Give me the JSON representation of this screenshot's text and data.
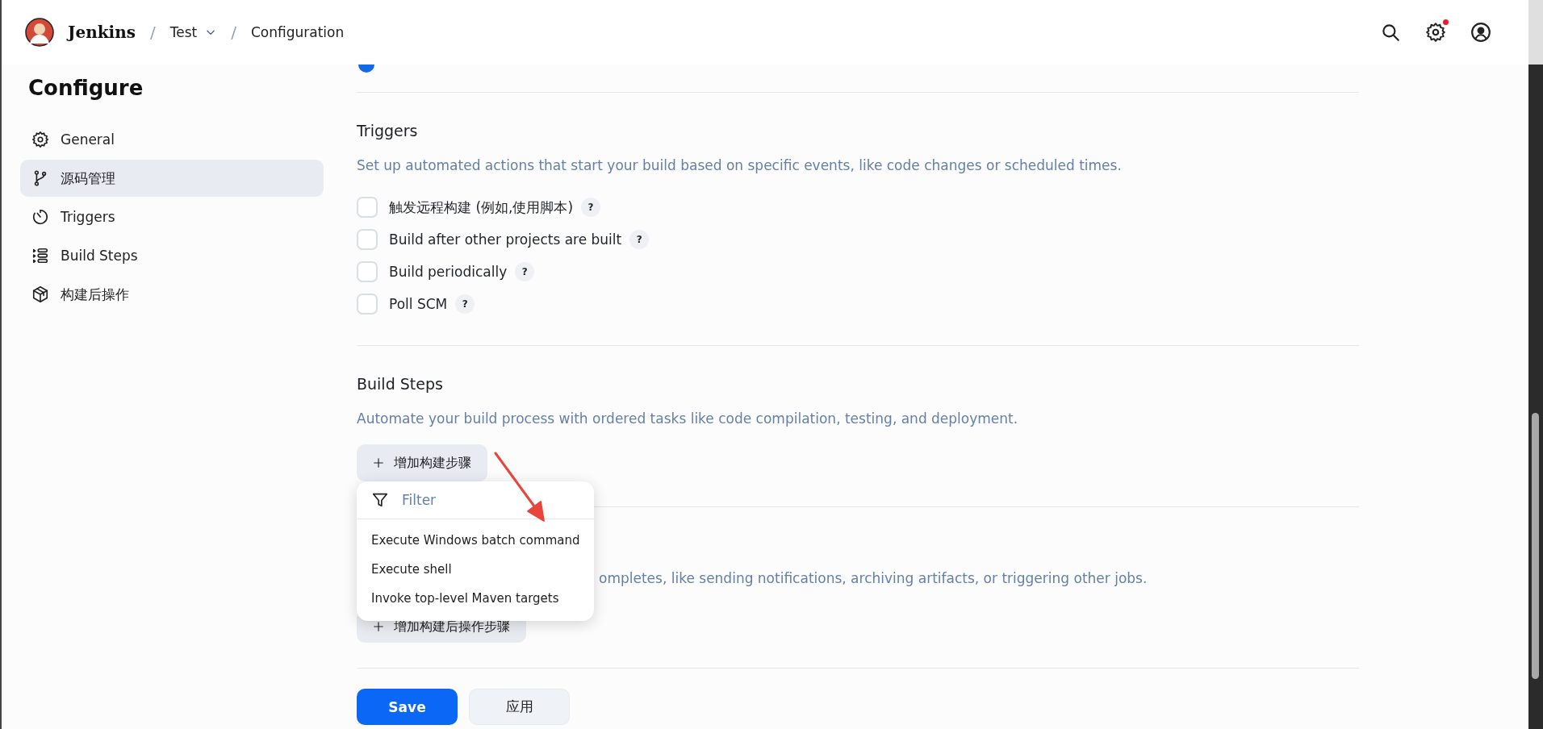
{
  "header": {
    "app_name": "Jenkins",
    "breadcrumbs": [
      {
        "separator": "/",
        "label": "Test",
        "dropdown": true
      },
      {
        "separator": "/",
        "label": "Configuration",
        "dropdown": false
      }
    ],
    "settings_alert": true
  },
  "sidebar": {
    "title": "Configure",
    "items": [
      {
        "label": "General",
        "selected": false
      },
      {
        "label": "源码管理",
        "selected": true
      },
      {
        "label": "Triggers",
        "selected": false
      },
      {
        "label": "Build Steps",
        "selected": false
      },
      {
        "label": "构建后操作",
        "selected": false
      }
    ]
  },
  "previous_section": {
    "radio_selected": true
  },
  "sections": [
    {
      "kind": "triggers",
      "title": "Triggers",
      "description": "Set up automated actions that start your build based on specific events, like code changes or scheduled times.",
      "options": [
        {
          "label": "触发远程构建 (例如,使用脚本)",
          "checked": false,
          "help": "?"
        },
        {
          "label": "Build after other projects are built",
          "checked": false,
          "help": "?"
        },
        {
          "label": "Build periodically",
          "checked": false,
          "help": "?"
        },
        {
          "label": "Poll SCM",
          "checked": false,
          "help": "?"
        }
      ]
    },
    {
      "kind": "build_steps",
      "title": "Build Steps",
      "description": "Automate your build process with ordered tasks like code compilation, testing, and deployment.",
      "add_button": "增加构建步骤",
      "menu": {
        "filter_placeholder": "Filter",
        "items": [
          {
            "label": "Execute Windows batch command"
          },
          {
            "label": "Execute shell"
          },
          {
            "label": "Invoke top-level Maven targets"
          }
        ]
      }
    },
    {
      "kind": "post_build",
      "description": "ompletes, like sending notifications, archiving artifacts, or triggering other jobs.",
      "add_button": "增加构建后操作步骤"
    }
  ],
  "actions": [
    {
      "label": "Save",
      "kind": "primary"
    },
    {
      "label": "应用",
      "kind": "secondary"
    }
  ]
}
